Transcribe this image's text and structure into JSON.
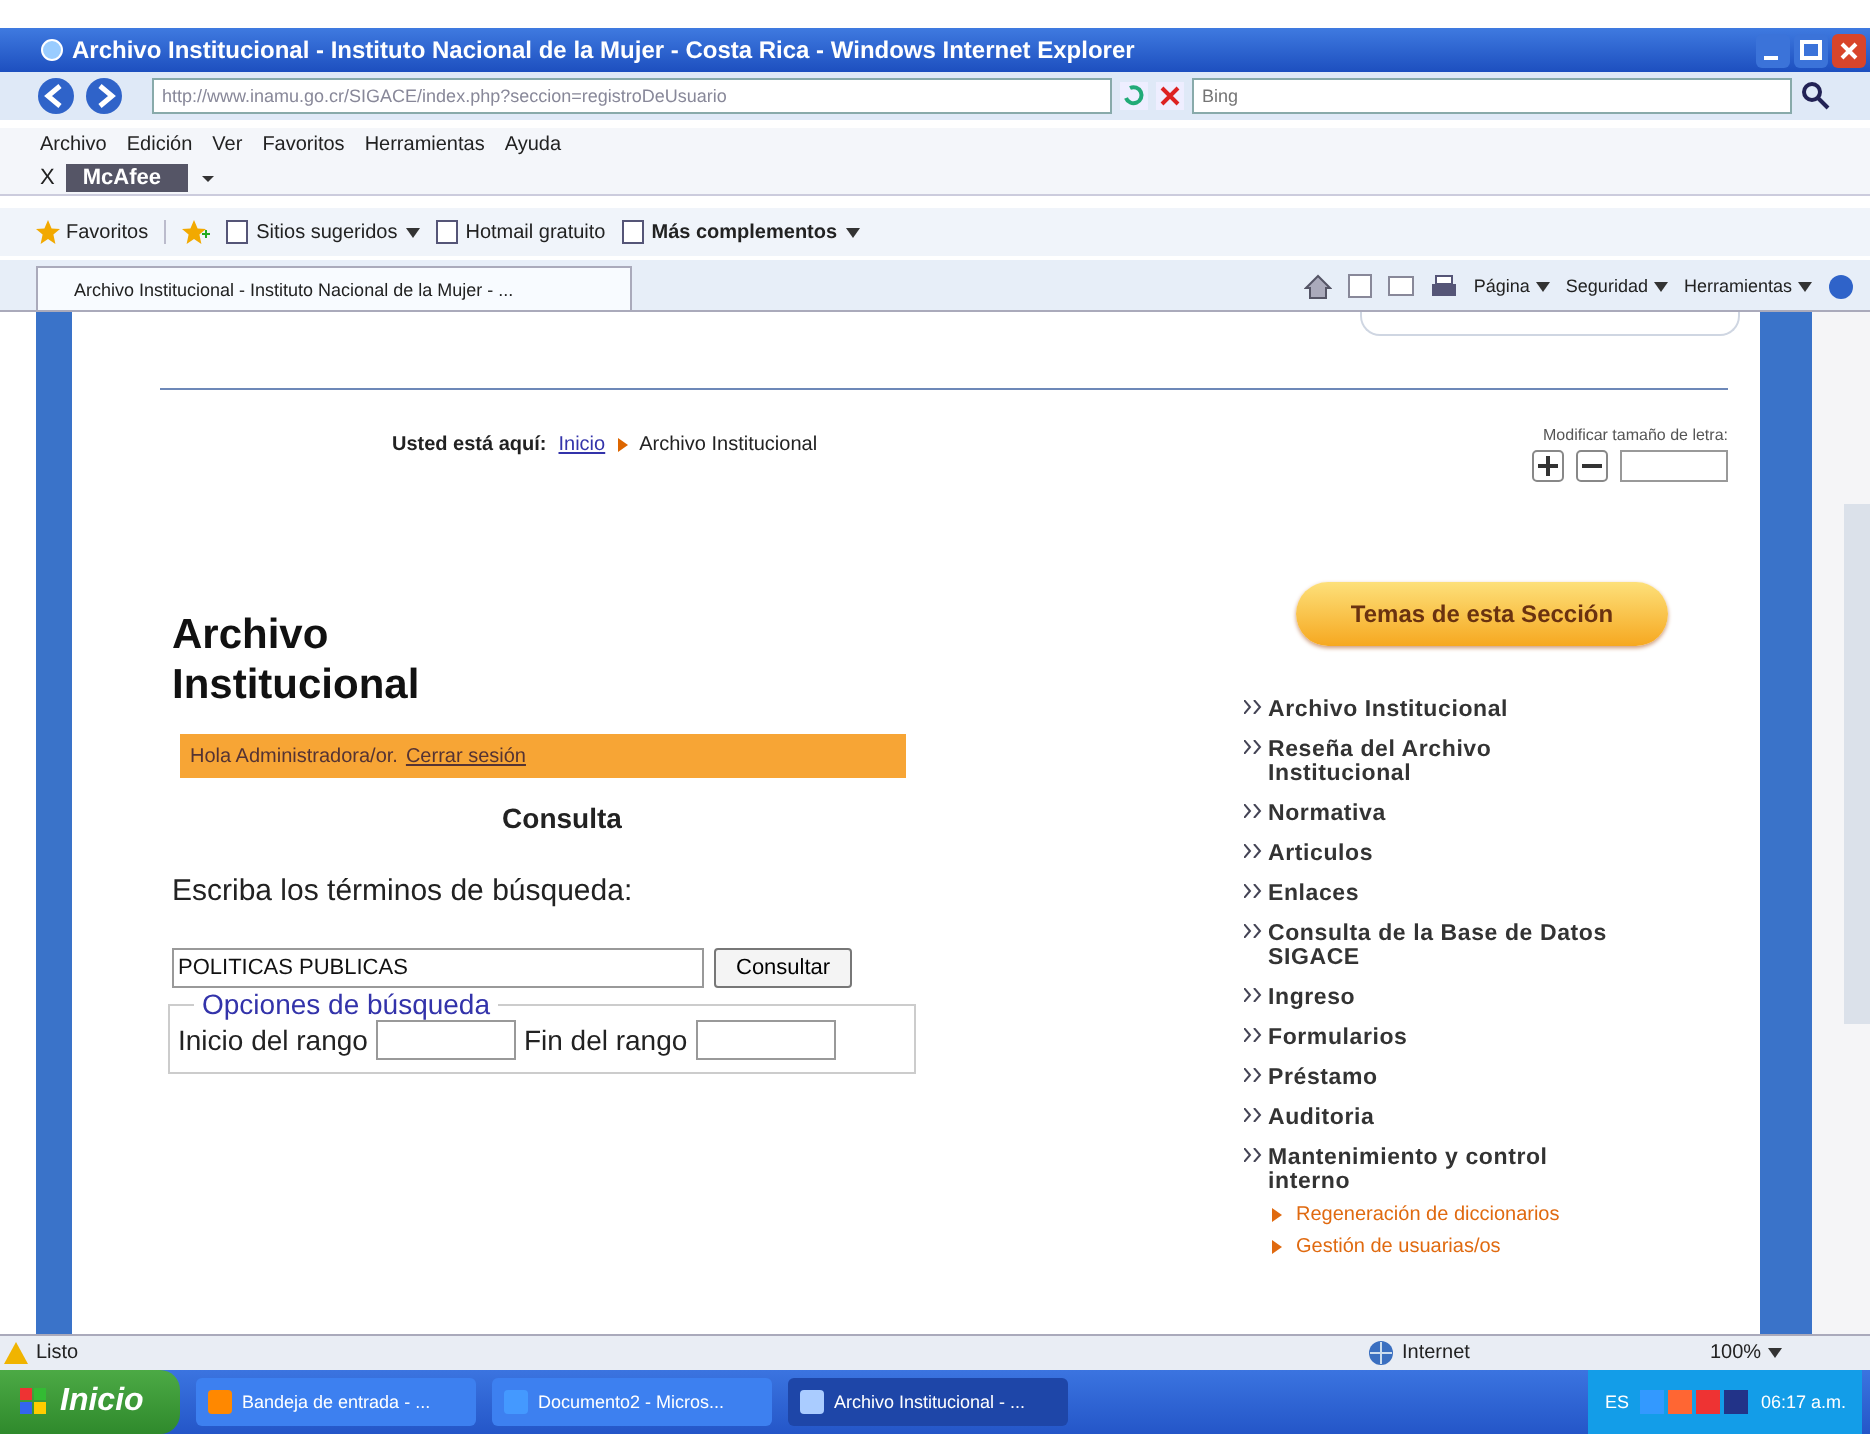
{
  "window": {
    "title": "Archivo Institucional - Instituto Nacional de la Mujer - Costa Rica - Windows Internet Explorer"
  },
  "address_bar": {
    "url": "http://www.inamu.go.cr/SIGACE/index.php?seccion=registroDeUsuario",
    "search_placeholder": "Bing"
  },
  "menu": [
    "Archivo",
    "Edición",
    "Ver",
    "Favoritos",
    "Herramientas",
    "Ayuda"
  ],
  "toolbar": {
    "close": "X",
    "brand": "McAfee"
  },
  "favorites_bar": {
    "favorites": "Favoritos",
    "links": [
      {
        "label": "Sitios sugeridos",
        "dropdown": true,
        "bold": false
      },
      {
        "label": "Hotmail gratuito",
        "dropdown": false,
        "bold": false
      },
      {
        "label": "Más complementos",
        "dropdown": true,
        "bold": true
      }
    ]
  },
  "tab": {
    "label": "Archivo Institucional - Instituto Nacional de la Mujer - ..."
  },
  "command_bar": [
    "Página",
    "Seguridad",
    "Herramientas"
  ],
  "page": {
    "breadcrumb": {
      "label": "Usted está aquí:",
      "link": "Inicio",
      "current": "Archivo Institucional"
    },
    "font_size": {
      "label": "Modificar tamaño de letra:"
    },
    "heading": "Archivo Institucional",
    "greeting": {
      "text": "Hola Administradora/or.",
      "link": "Cerrar sesión"
    },
    "section_title": "Consulta",
    "prompt": "Escriba los términos de búsqueda:",
    "search": {
      "value": "POLITICAS PUBLICAS",
      "button": "Consultar"
    },
    "options": {
      "legend": "Opciones de búsqueda",
      "start_label": "Inicio del rango",
      "end_label": "Fin del rango"
    },
    "sidebar": {
      "title": "Temas de esta Sección",
      "items": [
        {
          "label": "Archivo Institucional"
        },
        {
          "label": "Reseña del Archivo Institucional"
        },
        {
          "label": "Normativa"
        },
        {
          "label": "Articulos"
        },
        {
          "label": "Enlaces"
        },
        {
          "label": "Consulta de la Base de Datos SIGACE"
        },
        {
          "label": "Ingreso"
        },
        {
          "label": "Formularios"
        },
        {
          "label": "Préstamo"
        },
        {
          "label": "Auditoria"
        },
        {
          "label": "Mantenimiento y control interno",
          "children": [
            {
              "label": "Regeneración de diccionarios"
            },
            {
              "label": "Gestión de usuarias/os"
            }
          ]
        }
      ]
    }
  },
  "status_bar": {
    "text": "Listo",
    "zone": "Internet",
    "zoom": "100%"
  },
  "taskbar": {
    "start": "Inicio",
    "items": [
      {
        "label": "Bandeja de entrada - ...",
        "selected": false
      },
      {
        "label": "Documento2 - Micros...",
        "selected": false
      },
      {
        "label": "Archivo Institucional - ...",
        "selected": true
      }
    ],
    "tray": {
      "language": "ES",
      "time": "06:17 a.m."
    }
  }
}
